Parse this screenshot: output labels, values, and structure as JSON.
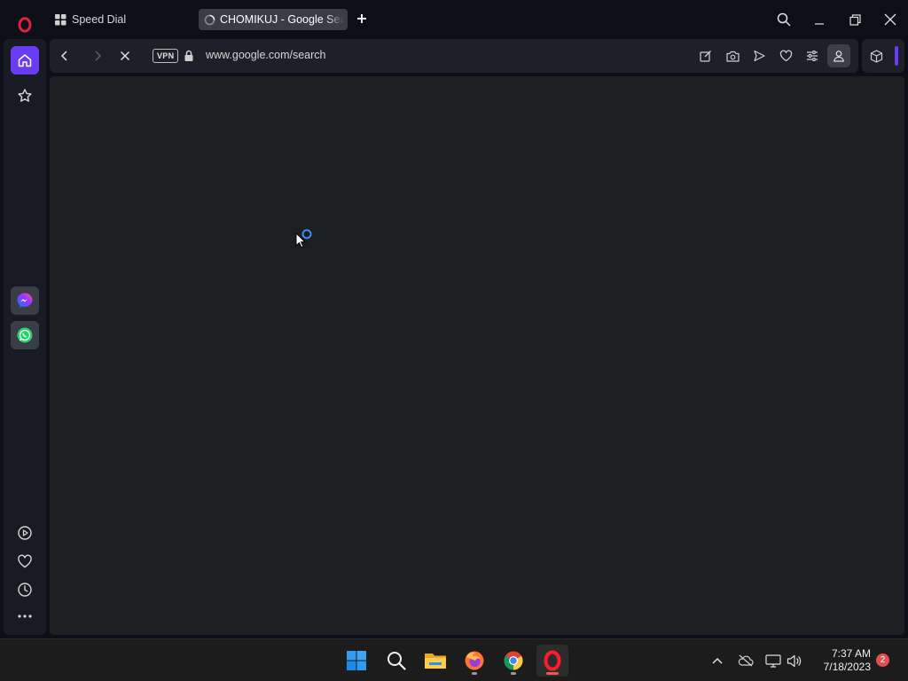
{
  "browser": {
    "tabs": [
      {
        "label": "Speed Dial",
        "active": false,
        "icon": "grid-icon"
      },
      {
        "label": "CHOMIKUJ - Google Search",
        "active": true,
        "icon": "loading-spinner-icon"
      }
    ],
    "address_bar": {
      "vpn_label": "VPN",
      "url": "www.google.com/search"
    },
    "colors": {
      "accent": "#6a3cf6",
      "opera_red": "#e0213a",
      "background": "#0c0e18",
      "content": "#1d1e22"
    }
  },
  "sidebar": {
    "items": [
      "home-icon",
      "star-icon",
      "messenger-icon",
      "whatsapp-icon",
      "player-icon",
      "heart-icon",
      "history-icon",
      "more-icon"
    ]
  },
  "taskbar": {
    "apps": [
      "windows-start-icon",
      "search-icon",
      "file-explorer-icon",
      "firefox-icon",
      "chrome-icon",
      "opera-icon"
    ],
    "clock": {
      "time": "7:37 AM",
      "date": "7/18/2023"
    },
    "notification_count": "2"
  }
}
